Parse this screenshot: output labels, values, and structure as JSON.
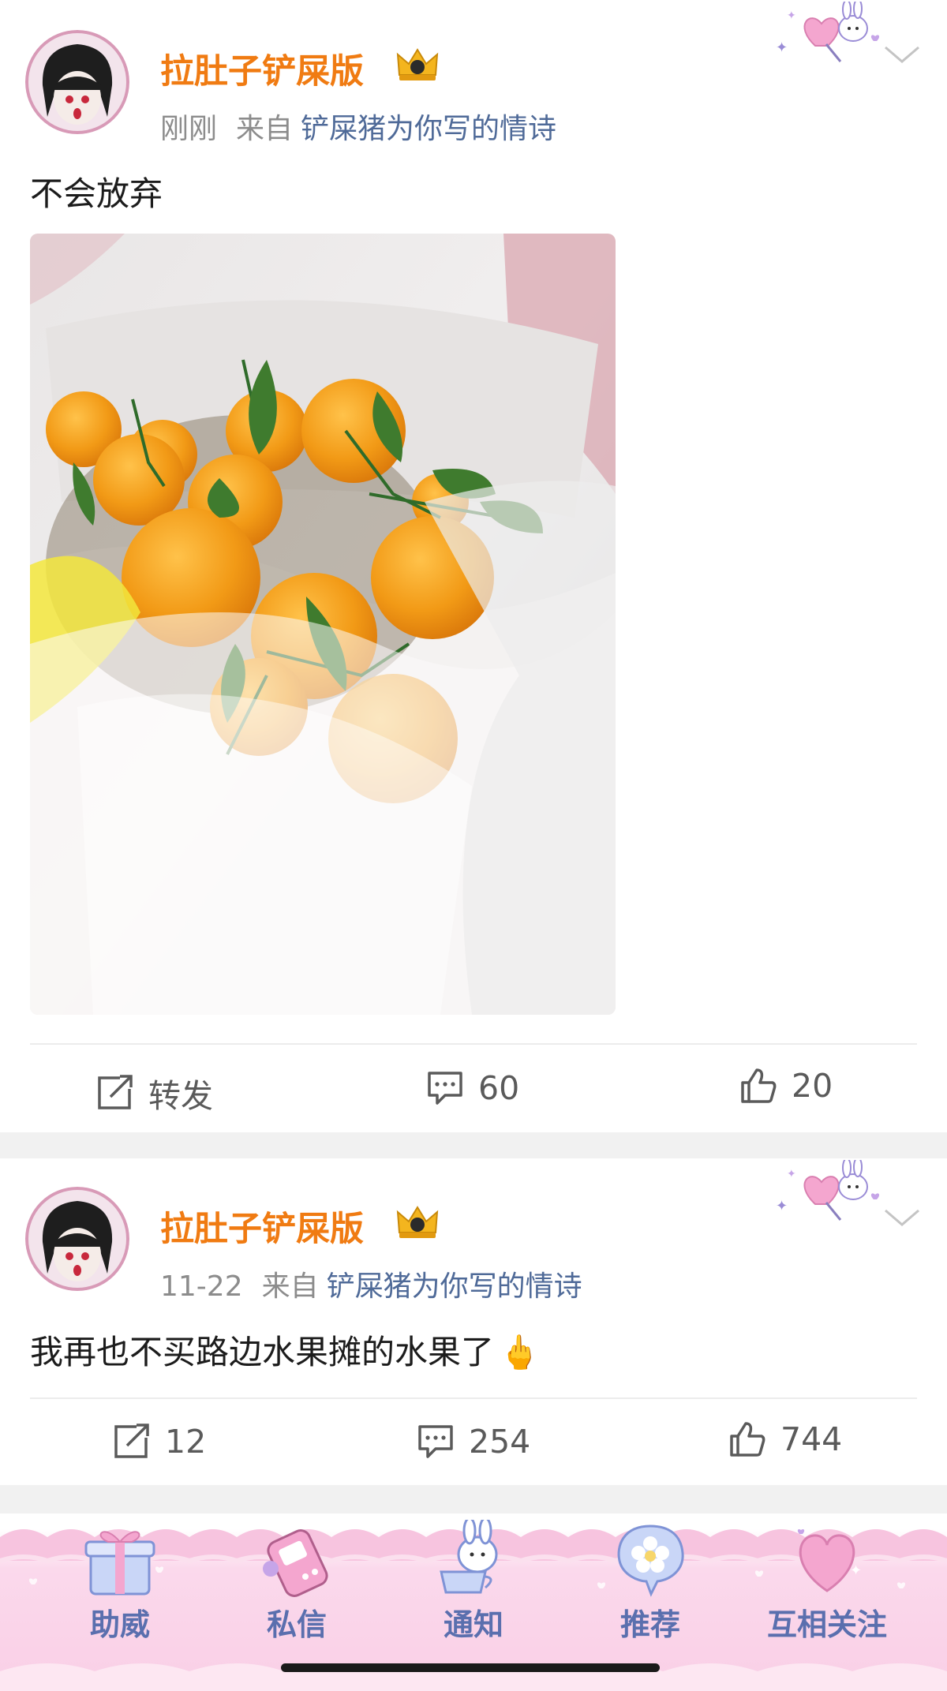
{
  "posts": [
    {
      "username": "拉肚子铲屎版",
      "time": "刚刚",
      "source_prefix": "来自",
      "source": "铲屎猪为你写的情诗",
      "text": "不会放弃",
      "has_photo": true,
      "actions": {
        "repost": "转发",
        "comments": "60",
        "likes": "20"
      }
    },
    {
      "username": "拉肚子铲屎版",
      "time": "11-22",
      "source_prefix": "来自",
      "source": "铲屎猪为你写的情诗",
      "text": "我再也不买路边水果摊的水果了",
      "emoji": "🖕",
      "has_photo": false,
      "actions": {
        "repost": "12",
        "comments": "254",
        "likes": "744"
      }
    }
  ],
  "tabbar": {
    "items": [
      {
        "label": "助威",
        "icon": "gift-icon"
      },
      {
        "label": "私信",
        "icon": "phone-icon"
      },
      {
        "label": "通知",
        "icon": "bunny-cup-icon"
      },
      {
        "label": "推荐",
        "icon": "flower-bubble-icon"
      },
      {
        "label": "互相关注",
        "icon": "heart-icon"
      }
    ]
  },
  "colors": {
    "username": "#f07b12",
    "source_link": "#4f6a98",
    "tab_label": "#5a6fae",
    "tabbar_pink": "#f9cfe6"
  }
}
